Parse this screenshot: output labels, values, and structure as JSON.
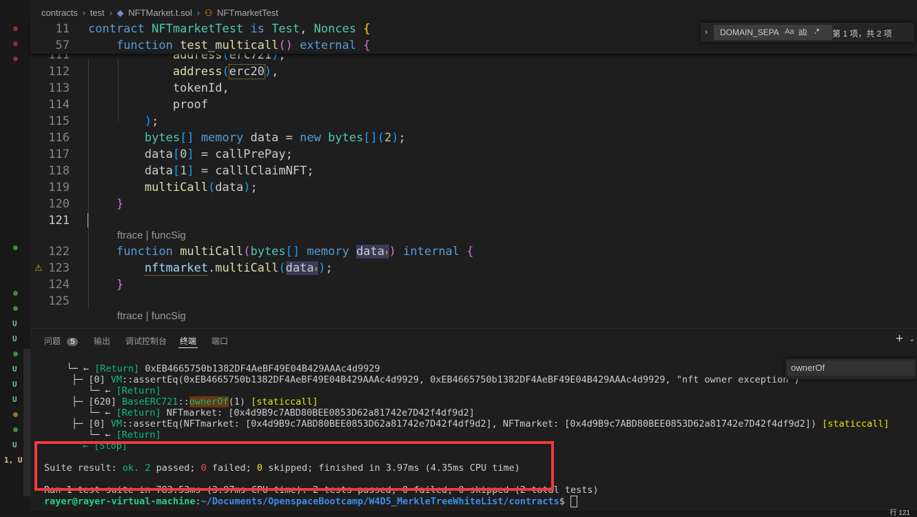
{
  "breadcrumb": [
    "contracts",
    "test",
    "NFTMarket.t.sol",
    "NFTmarketTest"
  ],
  "editor": {
    "sticky": [
      {
        "ln": "11",
        "code": "contract NFTmarketTest is Test, Nonces {"
      },
      {
        "ln": "57",
        "code": "    function test_multicall() external {"
      }
    ],
    "lines": [
      {
        "ln": "111",
        "code": "            address(erc721),"
      },
      {
        "ln": "112",
        "code": "            address(erc20),"
      },
      {
        "ln": "113",
        "code": "            tokenId,"
      },
      {
        "ln": "114",
        "code": "            proof"
      },
      {
        "ln": "115",
        "code": "        );"
      },
      {
        "ln": "116",
        "code": "        bytes[] memory data = new bytes[](2);"
      },
      {
        "ln": "117",
        "code": "        data[0] = callPrePay;"
      },
      {
        "ln": "118",
        "code": "        data[1] = calllClaimNFT;"
      },
      {
        "ln": "119",
        "code": "        multiCall(data);"
      },
      {
        "ln": "120",
        "code": "    }"
      },
      {
        "ln": "121",
        "code": ""
      },
      {
        "ln": "122",
        "code": "    function multiCall(bytes[] memory data⬆) internal {"
      },
      {
        "ln": "123",
        "code": "        nftmarket.multiCall(data⬆);"
      },
      {
        "ln": "124",
        "code": "    }"
      },
      {
        "ln": "125",
        "code": ""
      }
    ],
    "codelens": "ftrace | funcSig"
  },
  "find": {
    "value": "DOMAIN_SEPA",
    "opt_case": "Aa",
    "opt_word": "ab",
    "opt_regex": ".*",
    "result": "第 1 项，共 2 项"
  },
  "panel": {
    "tabs": [
      "问题",
      "输出",
      "调试控制台",
      "终端",
      "端口"
    ],
    "problems_count": "5",
    "active_tab": "终端"
  },
  "terminal_search": "ownerOf",
  "terminal": {
    "l1_arrow": "    └─ ← ",
    "l1_ret": "[Return]",
    "l1_val": " 0xEB4665750b1382DF4AeBF49E04B429AAAc4d9929",
    "l2_pre": "├─ [0] ",
    "l2_vm": "VM",
    "l2_rest": "::assertEq(0xEB4665750b1382DF4AeBF49E04B429AAAc4d9929, 0xEB4665750b1382DF4AeBF49E04B429AAAc4d9929, \"nft owner exception\")",
    "l3_ret": "[Return]",
    "l4_pre": "├─ [620] ",
    "l4_base": "BaseERC721",
    "l4_sep": "::",
    "l4_owner": "ownerOf",
    "l4_arg": "(1) ",
    "l4_static": "[staticcall]",
    "l5_ret": "[Return]",
    "l5_val": " NFTmarket: [0x4d9B9c7ABD80BEE0853D62a81742e7D42f4df9d2]",
    "l6_pre": "├─ [0] ",
    "l6_vm": "VM",
    "l6_rest": "::assertEq(NFTmarket: [0x4d9B9c7ABD80BEE0853D62a81742e7D42f4df9d2], NFTmarket: [0x4d9B9c7ABD80BEE0853D62a81742e7D42f4df9d2]) ",
    "l6_static": "[staticcall]",
    "l7_ret": "[Return]",
    "l8_stop": "← [Stop]",
    "suite_label": "Suite result: ",
    "suite_ok": "ok.",
    "suite_passed_n": "2",
    "suite_passed": " passed; ",
    "suite_failed_n": "0",
    "suite_failed": " failed; ",
    "suite_skipped_n": "0",
    "suite_rest": " skipped; finished in 3.97ms (4.35ms CPU time)",
    "ran": "Ran 1 test suite in 783.53ms (3.97ms CPU time): 2 tests passed, 0 failed, 0 skipped (2 total tests)",
    "prompt_user": "rayer@rayer-virtual-machine",
    "prompt_colon": ":",
    "prompt_path": "~/Documents/OpenspaceBootcamp/W4D5_MerkleTreeWhiteList/contracts",
    "prompt_dollar": "$ "
  },
  "status": {
    "position": "行 121"
  },
  "colors": {
    "highlight_box": "#ef3b3b",
    "accent": "#0078d4"
  }
}
